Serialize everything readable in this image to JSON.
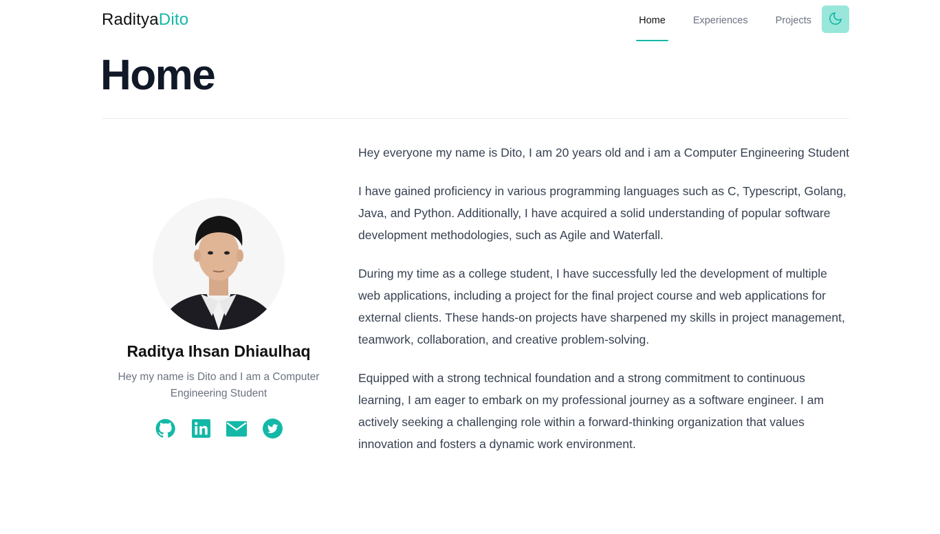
{
  "nav": {
    "logo_primary": "Raditya",
    "logo_accent": "Dito",
    "links": [
      {
        "label": "Home",
        "active": true
      },
      {
        "label": "Experiences",
        "active": false
      },
      {
        "label": "Projects",
        "active": false
      }
    ],
    "theme_toggle_icon": "moon-icon"
  },
  "page": {
    "title": "Home"
  },
  "profile": {
    "name": "Raditya Ihsan Dhiaulhaq",
    "tagline": "Hey my name is Dito and I am a Computer Engineering Student",
    "socials": [
      {
        "icon": "github-icon"
      },
      {
        "icon": "linkedin-icon"
      },
      {
        "icon": "mail-icon"
      },
      {
        "icon": "twitter-icon"
      }
    ]
  },
  "about": {
    "paragraphs": [
      "Hey everyone my name is Dito, I am 20 years old and i am a Computer Engineering Student",
      "I have gained proficiency in various programming languages such as C, Typescript, Golang, Java, and Python. Additionally, I have acquired a solid understanding of popular software development methodologies, such as Agile and Waterfall.",
      "During my time as a college student, I have successfully led the development of multiple web applications, including a project for the final project course and web applications for external clients. These hands-on projects have sharpened my skills in project management, teamwork, collaboration, and creative problem-solving.",
      "Equipped with a strong technical foundation and a strong commitment to continuous learning, I am eager to embark on my professional journey as a software engineer. I am actively seeking a challenging role within a forward-thinking organization that values innovation and fosters a dynamic work environment."
    ]
  },
  "colors": {
    "accent": "#14b8a6",
    "toggle_bg": "#99e6da",
    "heading": "#111827",
    "body_text": "#374151",
    "muted_text": "#6b7280"
  }
}
